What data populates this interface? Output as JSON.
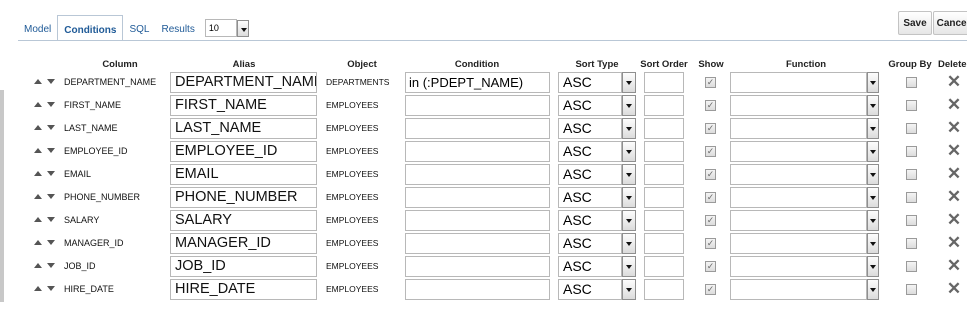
{
  "tabs": [
    {
      "label": "Model"
    },
    {
      "label": "Conditions"
    },
    {
      "label": "SQL"
    },
    {
      "label": "Results"
    }
  ],
  "results_count": "10",
  "buttons": {
    "save": "Save",
    "cancel": "Cancel"
  },
  "columns": {
    "column": "Column",
    "alias": "Alias",
    "object": "Object",
    "condition": "Condition",
    "sort_type": "Sort Type",
    "sort_order": "Sort Order",
    "show": "Show",
    "function": "Function",
    "group_by": "Group By",
    "delete": "Delete"
  },
  "rows": [
    {
      "column": "DEPARTMENT_NAME",
      "alias": "DEPARTMENT_NAME",
      "object": "DEPARTMENTS",
      "condition": "in (:PDEPT_NAME)",
      "sort_type": "ASC",
      "show": true,
      "group_by": false
    },
    {
      "column": "FIRST_NAME",
      "alias": "FIRST_NAME",
      "object": "EMPLOYEES",
      "condition": "",
      "sort_type": "ASC",
      "show": true,
      "group_by": false
    },
    {
      "column": "LAST_NAME",
      "alias": "LAST_NAME",
      "object": "EMPLOYEES",
      "condition": "",
      "sort_type": "ASC",
      "show": true,
      "group_by": false
    },
    {
      "column": "EMPLOYEE_ID",
      "alias": "EMPLOYEE_ID",
      "object": "EMPLOYEES",
      "condition": "",
      "sort_type": "ASC",
      "show": true,
      "group_by": false
    },
    {
      "column": "EMAIL",
      "alias": "EMAIL",
      "object": "EMPLOYEES",
      "condition": "",
      "sort_type": "ASC",
      "show": true,
      "group_by": false
    },
    {
      "column": "PHONE_NUMBER",
      "alias": "PHONE_NUMBER",
      "object": "EMPLOYEES",
      "condition": "",
      "sort_type": "ASC",
      "show": true,
      "group_by": false
    },
    {
      "column": "SALARY",
      "alias": "SALARY",
      "object": "EMPLOYEES",
      "condition": "",
      "sort_type": "ASC",
      "show": true,
      "group_by": false
    },
    {
      "column": "MANAGER_ID",
      "alias": "MANAGER_ID",
      "object": "EMPLOYEES",
      "condition": "",
      "sort_type": "ASC",
      "show": true,
      "group_by": false
    },
    {
      "column": "JOB_ID",
      "alias": "JOB_ID",
      "object": "EMPLOYEES",
      "condition": "",
      "sort_type": "ASC",
      "show": true,
      "group_by": false
    },
    {
      "column": "HIRE_DATE",
      "alias": "HIRE_DATE",
      "object": "EMPLOYEES",
      "condition": "",
      "sort_type": "ASC",
      "show": true,
      "group_by": false
    }
  ],
  "icons": {
    "move_up": "arrow-up-icon",
    "move_down": "arrow-down-icon",
    "delete": "delete-x-icon",
    "dropdown": "chevron-down-icon"
  }
}
